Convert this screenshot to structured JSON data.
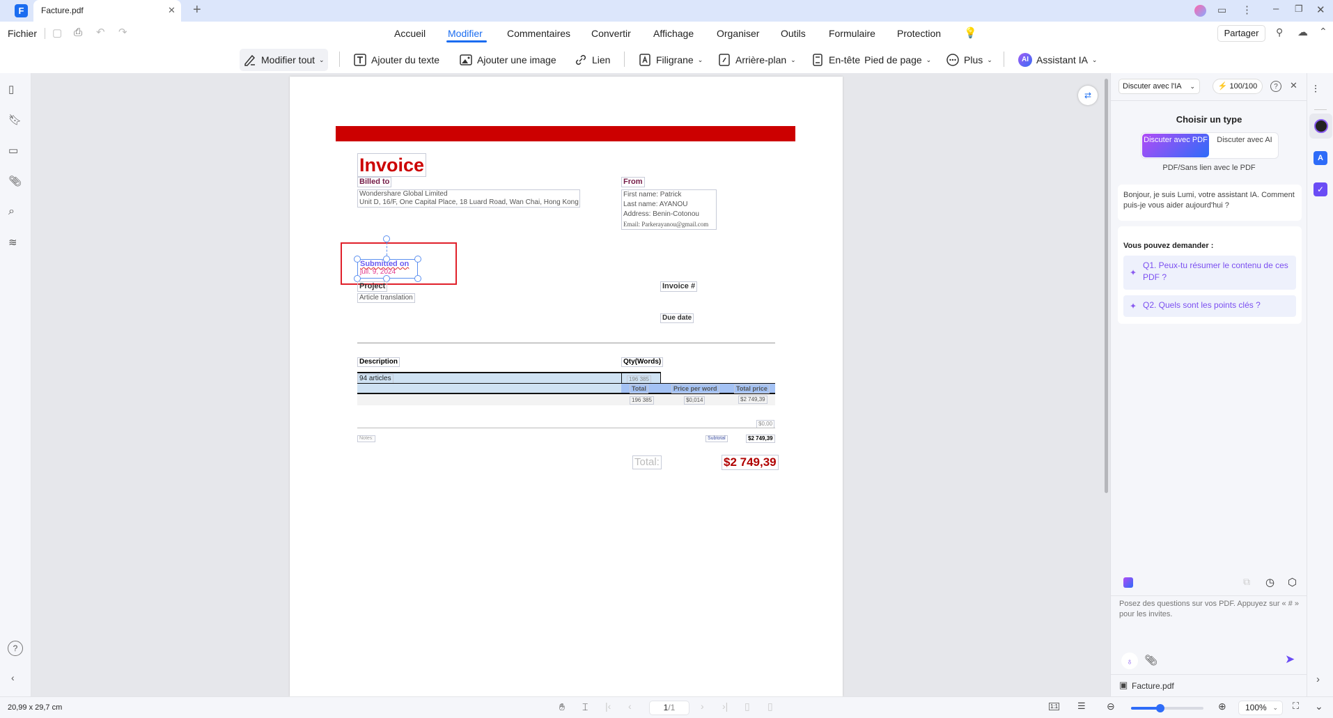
{
  "tab": {
    "title": "Facture.pdf"
  },
  "menubar": {
    "file": "Fichier",
    "items": [
      "Accueil",
      "Modifier",
      "Commentaires",
      "Convertir",
      "Affichage",
      "Organiser",
      "Outils",
      "Formulaire",
      "Protection"
    ],
    "active": "Modifier",
    "share": "Partager"
  },
  "toolbar": {
    "edit_all": "Modifier tout",
    "add_text": "Ajouter du texte",
    "add_image": "Ajouter une image",
    "link": "Lien",
    "watermark": "Filigrane",
    "background": "Arrière-plan",
    "header": "En-tête",
    "footer": "Pied de page",
    "more": "Plus",
    "ai": "Assistant IA",
    "ai_badge": "AI"
  },
  "colors": {
    "accent": "#1a6cf0",
    "invoice_red": "#cc0000",
    "header_blue": "#a4c2f4",
    "row_blue": "#cfe2f3"
  },
  "invoice": {
    "title": "Invoice",
    "billed_to": "Billed to",
    "billed_lines": [
      "Wondershare Global Limited",
      "Unit D, 16/F, One Capital Place, 18 Luard Road, Wan Chai, Hong Kong"
    ],
    "from": "From",
    "from_lines": [
      "First name: Patrick",
      "Last name: AYANOU",
      "Address: Benin-Cotonou",
      "Email: Parkerayanou@gmail.com"
    ],
    "submitted_on": "Submitted on",
    "submitted_date": "juil. 9, 2024",
    "project": "Project",
    "project_value": "Article translation",
    "invoice_no": "Invoice #",
    "due_date": "Due date",
    "table": {
      "description": "Description",
      "qty": "Qty(Words)",
      "item": "94 articles",
      "item_qty": "196 385",
      "headers": [
        "Total",
        "Price per word",
        "Total price"
      ],
      "values": [
        "196 385",
        "$0,014",
        "$2 749,39"
      ]
    },
    "zero": "$0,00",
    "notes": "Notes:",
    "subtotal_label": "Subtotal",
    "subtotal": "$2 749,39",
    "total_label": "Total:",
    "total": "$2 749,39"
  },
  "ai_panel": {
    "mode": "Discuter avec l'IA",
    "credits": "100/100",
    "choose_type": "Choisir un type",
    "toggle": [
      "Discuter avec PDF",
      "Discuter avec AI"
    ],
    "toggle_active": 0,
    "subtitle": "PDF/Sans lien avec le PDF",
    "greeting": "Bonjour, je suis Lumi, votre assistant IA. Comment puis-je vous aider aujourd'hui ?",
    "ask_title": "Vous pouvez demander :",
    "suggestions": [
      "Q1. Peux-tu résumer le contenu de ces PDF ?",
      "Q2. Quels sont les points clés ?"
    ],
    "input_placeholder": "Posez des questions sur vos PDF. Appuyez sur « # » pour les invites.",
    "file": "Facture.pdf"
  },
  "status": {
    "dimensions": "20,99 x 29,7 cm",
    "page": "1",
    "page_total": "/1",
    "zoom": "100%",
    "zoom_slider_percent": 40,
    "fit_label": "1:1"
  }
}
